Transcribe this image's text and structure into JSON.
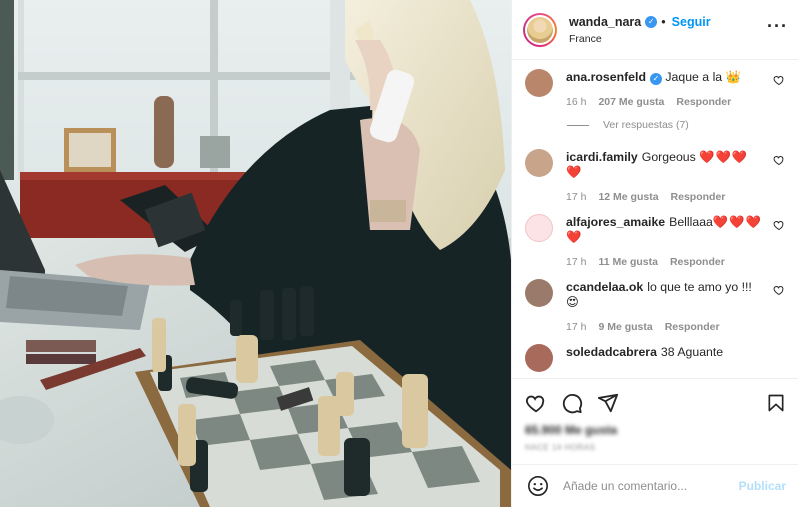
{
  "post": {
    "username": "wanda_nara",
    "follow_label": "Seguir",
    "location": "France",
    "likes": "65.900 Me gusta",
    "date": "HACE 14 HORAS"
  },
  "comments": [
    {
      "user": "ana.rosenfeld",
      "verified": true,
      "text": "Jaque a la ",
      "emoji": "👑",
      "time": "16 h",
      "likes": "207 Me gusta",
      "reply": "Responder",
      "avatar_color": "#b9866c"
    },
    {
      "user": "icardi.family",
      "text": "Gorgeous ",
      "hearts": "❤️❤️❤️❤️",
      "time": "17 h",
      "likes": "12 Me gusta",
      "reply": "Responder",
      "avatar_color": "#c8a48a"
    },
    {
      "user": "alfajores_amaike",
      "text": "Belllaaa",
      "hearts": "❤️❤️❤️",
      "hearts2": "❤️",
      "time": "17 h",
      "likes": "11 Me gusta",
      "reply": "Responder",
      "avatar_color": "#f3c4c9"
    },
    {
      "user": "ccandelaa.ok",
      "text": "lo que te amo yo !!!",
      "emoji": "😍",
      "time": "17 h",
      "likes": "9 Me gusta",
      "reply": "Responder",
      "avatar_color": "#9a7a6a"
    },
    {
      "user": "soledadcabrera",
      "text": "38 Aguante",
      "avatar_color": "#a86a5a"
    }
  ],
  "view_replies": "Ver respuestas (7)",
  "add_comment": {
    "placeholder": "Añade un comentario...",
    "submit_label": "Publicar"
  },
  "icons": [
    "heart-icon",
    "comment-icon",
    "share-icon",
    "bookmark-icon",
    "emoji-icon",
    "more-icon",
    "verified-icon"
  ],
  "colors": {
    "accent": "#0095f6",
    "heart": "#ed1c24",
    "text": "#262626",
    "muted": "#8e8e8e"
  }
}
